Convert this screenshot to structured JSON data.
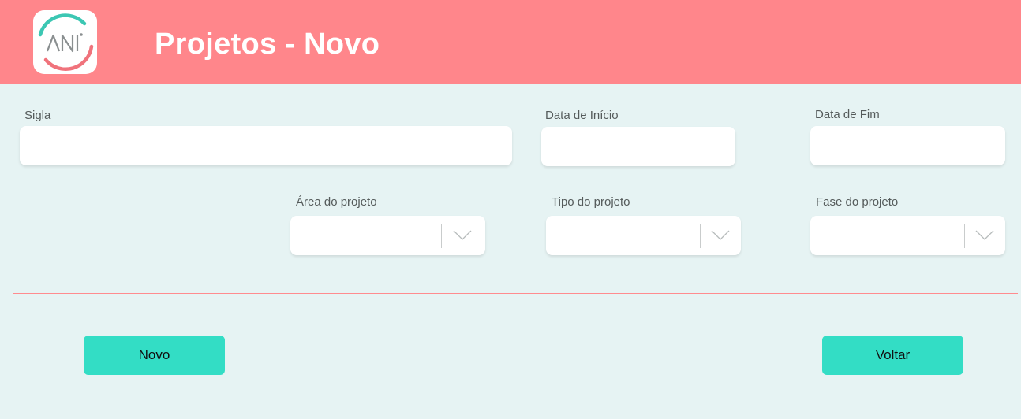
{
  "header": {
    "logo_text": "ANI",
    "title": "Projetos - Novo"
  },
  "form": {
    "sigla": {
      "label": "Sigla",
      "value": ""
    },
    "data_inicio": {
      "label": "Data de Início",
      "value": ""
    },
    "data_fim": {
      "label": "Data de Fim",
      "value": ""
    },
    "area_projeto": {
      "label": "Área do projeto",
      "selected": ""
    },
    "tipo_projeto": {
      "label": "Tipo do projeto",
      "selected": ""
    },
    "fase_projeto": {
      "label": "Fase do projeto",
      "selected": ""
    }
  },
  "actions": {
    "novo_label": "Novo",
    "voltar_label": "Voltar"
  },
  "colors": {
    "header_bg": "#ff868b",
    "page_bg": "#e6f3f3",
    "button_bg": "#33ddc5",
    "logo_teal": "#3cc7b3",
    "logo_pink": "#f0737c",
    "divider": "#ff8b8e"
  }
}
